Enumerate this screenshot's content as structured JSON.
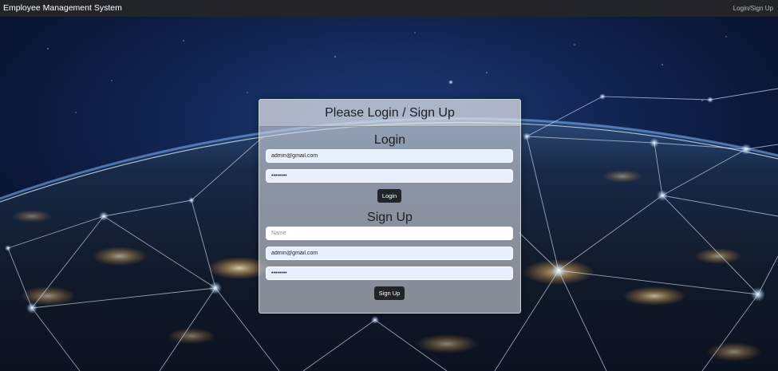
{
  "navbar": {
    "brand": "Employee Management System",
    "link": "Login/Sign Up"
  },
  "card": {
    "title": "Please Login / Sign Up"
  },
  "login": {
    "title": "Login",
    "email_value": "admin@gmail.com",
    "password_value": "password",
    "button_label": "Login"
  },
  "signup": {
    "title": "Sign Up",
    "name_placeholder": "Name",
    "email_value": "admin@gmail.com",
    "password_value": "password",
    "button_label": "Sign Up"
  },
  "colors": {
    "navbar": "#212529",
    "button": "#212529",
    "autofill_field": "#e8f0fe"
  },
  "background": "earth-network-night-image"
}
